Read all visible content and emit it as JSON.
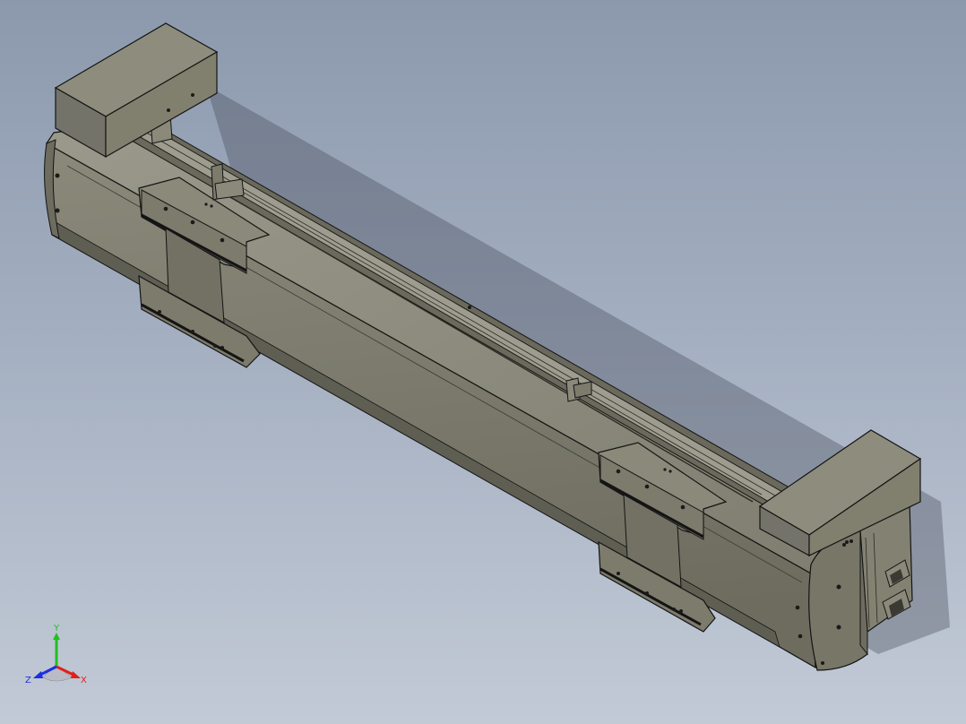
{
  "viewport": {
    "background_top": "#8c99ad",
    "background_bottom": "#c2cad6"
  },
  "model": {
    "body_color": "#7c7b6c",
    "body_light": "#8e8d7d",
    "body_dark": "#5f5e52",
    "edge_color": "#141414",
    "rail_color": "#9d9c8e"
  },
  "triad": {
    "x_label": "X",
    "y_label": "Y",
    "z_label": "Z",
    "x_color": "#e0201c",
    "y_color": "#1fc01f",
    "z_color": "#1c2fe0"
  }
}
